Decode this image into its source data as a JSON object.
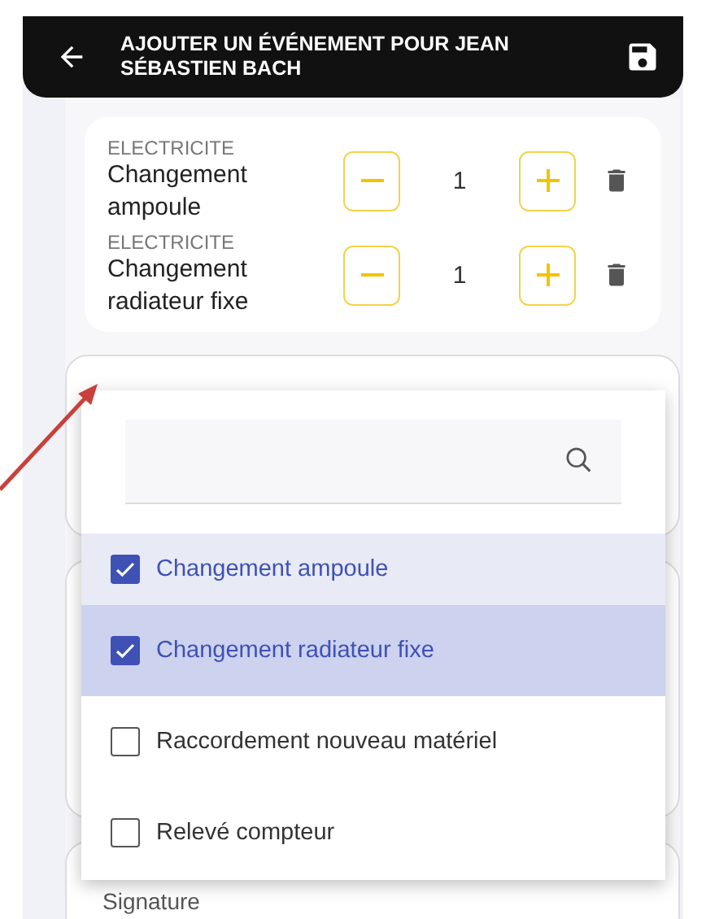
{
  "header": {
    "title": "AJOUTER UN ÉVÉNEMENT POUR JEAN SÉBASTIEN BACH"
  },
  "items": [
    {
      "category": "ELECTRICITE",
      "name": "Changement ampoule",
      "quantity": "1"
    },
    {
      "category": "ELECTRICITE",
      "name": "Changement radiateur fixe",
      "quantity": "1"
    }
  ],
  "dropdown": {
    "options": [
      {
        "label": "Changement ampoule",
        "checked": true,
        "focused": false
      },
      {
        "label": "Changement radiateur fixe",
        "checked": true,
        "focused": true
      },
      {
        "label": "Raccordement nouveau matériel",
        "checked": false,
        "focused": false
      },
      {
        "label": "Relevé compteur",
        "checked": false,
        "focused": false
      }
    ]
  },
  "signature": {
    "label": "Signature"
  }
}
